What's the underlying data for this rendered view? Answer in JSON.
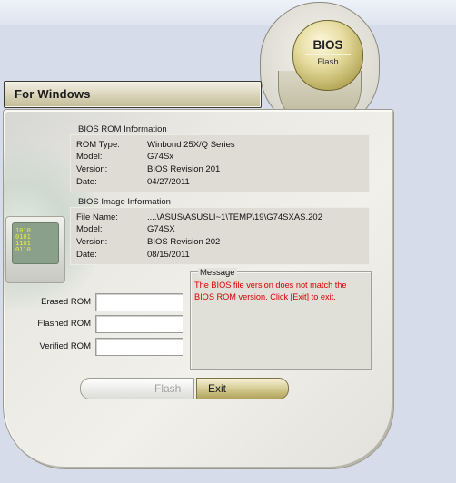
{
  "header": {
    "banner_label": "For Windows"
  },
  "badge": {
    "title": "BIOS",
    "subtitle": "Flash"
  },
  "rom_info": {
    "title": "BIOS ROM Information",
    "rows": [
      {
        "label": "ROM Type:",
        "value": "Winbond 25X/Q Series"
      },
      {
        "label": "Model:",
        "value": "G74Sx"
      },
      {
        "label": "Version:",
        "value": "BIOS Revision 201"
      },
      {
        "label": "Date:",
        "value": "04/27/2011"
      }
    ]
  },
  "image_info": {
    "title": "BIOS Image Information",
    "rows": [
      {
        "label": "File Name:",
        "value": "....\\ASUS\\ASUSLI~1\\TEMP\\19\\G74SXAS.202"
      },
      {
        "label": "Model:",
        "value": "G74SX"
      },
      {
        "label": "Version:",
        "value": "BIOS Revision 202"
      },
      {
        "label": "Date:",
        "value": "08/15/2011"
      }
    ]
  },
  "message": {
    "title": "Message",
    "text": "The BIOS file version does not match the BIOS ROM version. Click [Exit] to exit.",
    "color": "#d90000"
  },
  "progress": {
    "erased_label": "Erased ROM",
    "flashed_label": "Flashed ROM",
    "verified_label": "Verified ROM"
  },
  "buttons": {
    "flash_label": "Flash",
    "exit_label": "Exit"
  },
  "colors": {
    "accent_gold": "#c8bb78",
    "panel": "#e8e7e1",
    "background": "#d6dce9"
  },
  "icons": [
    "bios-flash-emblem",
    "computer-monitor-icon",
    "globe-graphic"
  ]
}
